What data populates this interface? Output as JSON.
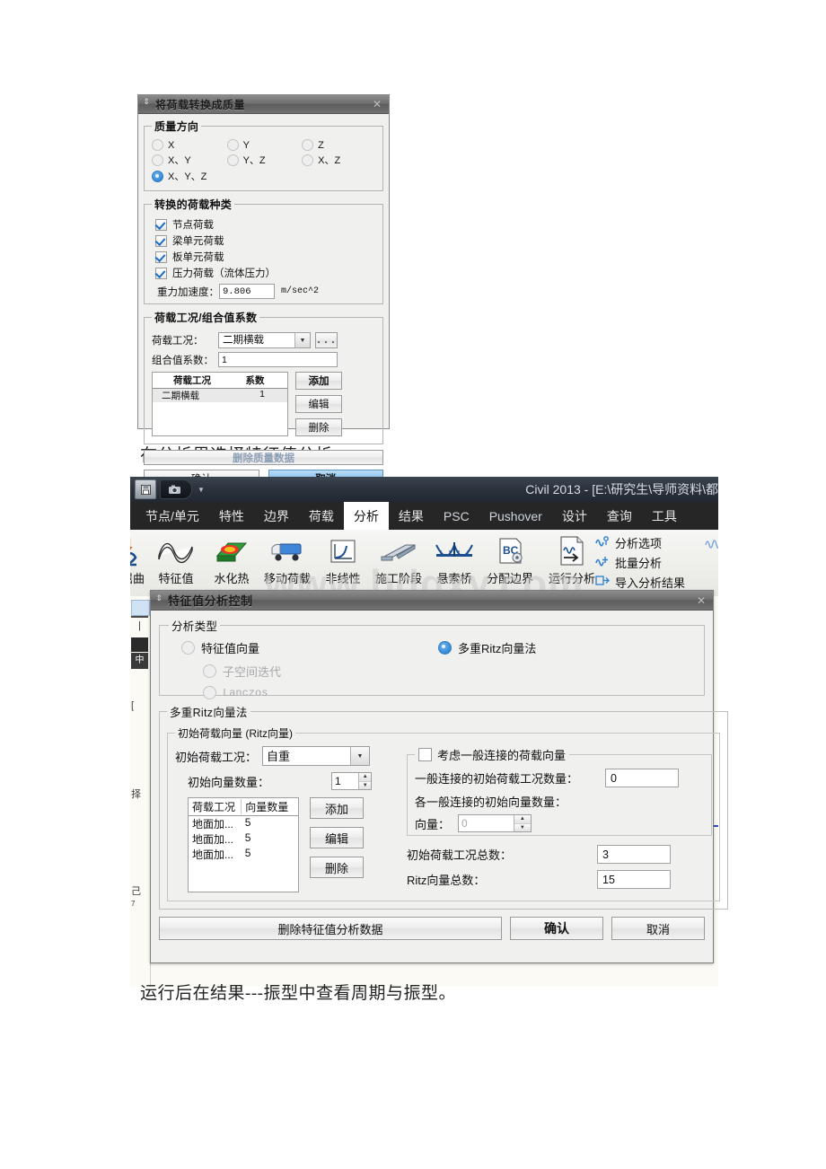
{
  "doc": {
    "line1": "在分析里选择特征值分析，",
    "line2": "运行后在结果---振型中查看周期与振型。"
  },
  "mass_dialog": {
    "title": "将荷载转换成质量",
    "pin_icon": "pin-icon",
    "close_icon": "close-icon",
    "direction_group": {
      "legend": "质量方向",
      "options": [
        {
          "label": "X",
          "selected": false
        },
        {
          "label": "Y",
          "selected": false
        },
        {
          "label": "Z",
          "selected": false
        },
        {
          "label": "X、Y",
          "selected": false
        },
        {
          "label": "Y、Z",
          "selected": false
        },
        {
          "label": "X、Z",
          "selected": false
        },
        {
          "label": "X、Y、Z",
          "selected": true
        }
      ]
    },
    "load_kind_group": {
      "legend": "转换的荷载种类",
      "checkboxes": [
        {
          "label": "节点荷载",
          "checked": true
        },
        {
          "label": "梁单元荷载",
          "checked": true
        },
        {
          "label": "板单元荷载",
          "checked": true
        },
        {
          "label": "压力荷载（流体压力）",
          "checked": true
        }
      ],
      "gravity_label": "重力加速度：",
      "gravity_value": "9.806",
      "gravity_unit": "m/sec^2"
    },
    "case_group": {
      "legend": "荷载工况/组合值系数",
      "case_label": "荷载工况：",
      "case_value": "二期横载",
      "more_button": "...",
      "factor_label": "组合值系数：",
      "factor_value": "1",
      "table": {
        "headers": [
          "荷载工况",
          "系数"
        ],
        "rows": [
          [
            "二期横载",
            "1"
          ]
        ]
      },
      "buttons": [
        "添加",
        "编辑",
        "删除"
      ]
    },
    "delete_mass_button": "删除质量数据",
    "ok_button": "确认",
    "cancel_button": "取消"
  },
  "civil_window": {
    "title": "Civil 2013 - [E:\\研究生\\导师资料\\都",
    "quick_access": [
      "save-icon",
      "camera-icon",
      "dropdown-caret-icon"
    ],
    "tabs": [
      {
        "label": "节点/单元",
        "active": false
      },
      {
        "label": "特性",
        "active": false
      },
      {
        "label": "边界",
        "active": false
      },
      {
        "label": "荷载",
        "active": false
      },
      {
        "label": "分析",
        "active": true
      },
      {
        "label": "结果",
        "active": false
      },
      {
        "label": "PSC",
        "active": false
      },
      {
        "label": "Pushover",
        "active": false
      },
      {
        "label": "设计",
        "active": false
      },
      {
        "label": "查询",
        "active": false
      },
      {
        "label": "工具",
        "active": false
      }
    ],
    "ribbon_items": [
      {
        "label": "屈曲",
        "icon": "buckling-icon"
      },
      {
        "label": "特征值",
        "icon": "eigenvalue-icon"
      },
      {
        "label": "水化热",
        "icon": "hydration-heat-icon"
      },
      {
        "label": "移动荷载",
        "icon": "moving-load-icon"
      },
      {
        "label": "非线性",
        "icon": "nonlinear-icon"
      },
      {
        "label": "施工阶段",
        "icon": "construction-stage-icon"
      },
      {
        "label": "悬索桥",
        "icon": "suspension-bridge-icon"
      },
      {
        "label": "分配边界",
        "icon": "boundary-bc-icon"
      }
    ],
    "ribbon_run": {
      "label": "运行分析",
      "icon": "run-analysis-icon"
    },
    "ribbon_list": [
      {
        "label": "分析选项",
        "icon": "analysis-options-icon"
      },
      {
        "label": "批量分析",
        "icon": "batch-analysis-icon"
      },
      {
        "label": "导入分析结果",
        "icon": "import-results-icon"
      }
    ],
    "watermark": "www.bdqxy.com"
  },
  "eigen_dialog": {
    "title": "特征值分析控制",
    "pin_icon": "pin-icon",
    "close_icon": "close-icon",
    "type_group": {
      "legend": "分析类型",
      "options": [
        {
          "label": "特征值向量",
          "selected": false,
          "disabled": false
        },
        {
          "label": "子空间迭代",
          "selected": false,
          "disabled": true
        },
        {
          "label": "Lanczos",
          "selected": false,
          "disabled": true
        },
        {
          "label": "多重Ritz向量法",
          "selected": true,
          "disabled": false
        }
      ]
    },
    "ritz_group": {
      "legend": "多重Ritz向量法",
      "initial_group": {
        "legend": "初始荷载向量 (Ritz向量)",
        "case_label": "初始荷载工况：",
        "case_value": "自重",
        "count_label": "初始向量数量：",
        "count_value": "1",
        "table": {
          "headers": [
            "荷载工况",
            "向量数量"
          ],
          "rows": [
            [
              "地面加...",
              "5"
            ],
            [
              "地面加...",
              "5"
            ],
            [
              "地面加...",
              "5"
            ]
          ]
        },
        "buttons": [
          "添加",
          "编辑",
          "删除"
        ],
        "general_link": {
          "checkbox_label": "考虑一般连接的荷载向量",
          "checked": false,
          "case_count_label": "一般连接的初始荷载工况数量：",
          "case_count_value": "0",
          "each_vector_label": "各一般连接的初始向量数量：",
          "vector_label": "向量：",
          "vector_value": "0"
        },
        "total_case_label": "初始荷载工况总数：",
        "total_case_value": "3",
        "total_ritz_label": "Ritz向量总数：",
        "total_ritz_value": "15"
      }
    },
    "delete_button": "删除特征值分析数据",
    "ok_button": "确认",
    "cancel_button": "取消"
  }
}
